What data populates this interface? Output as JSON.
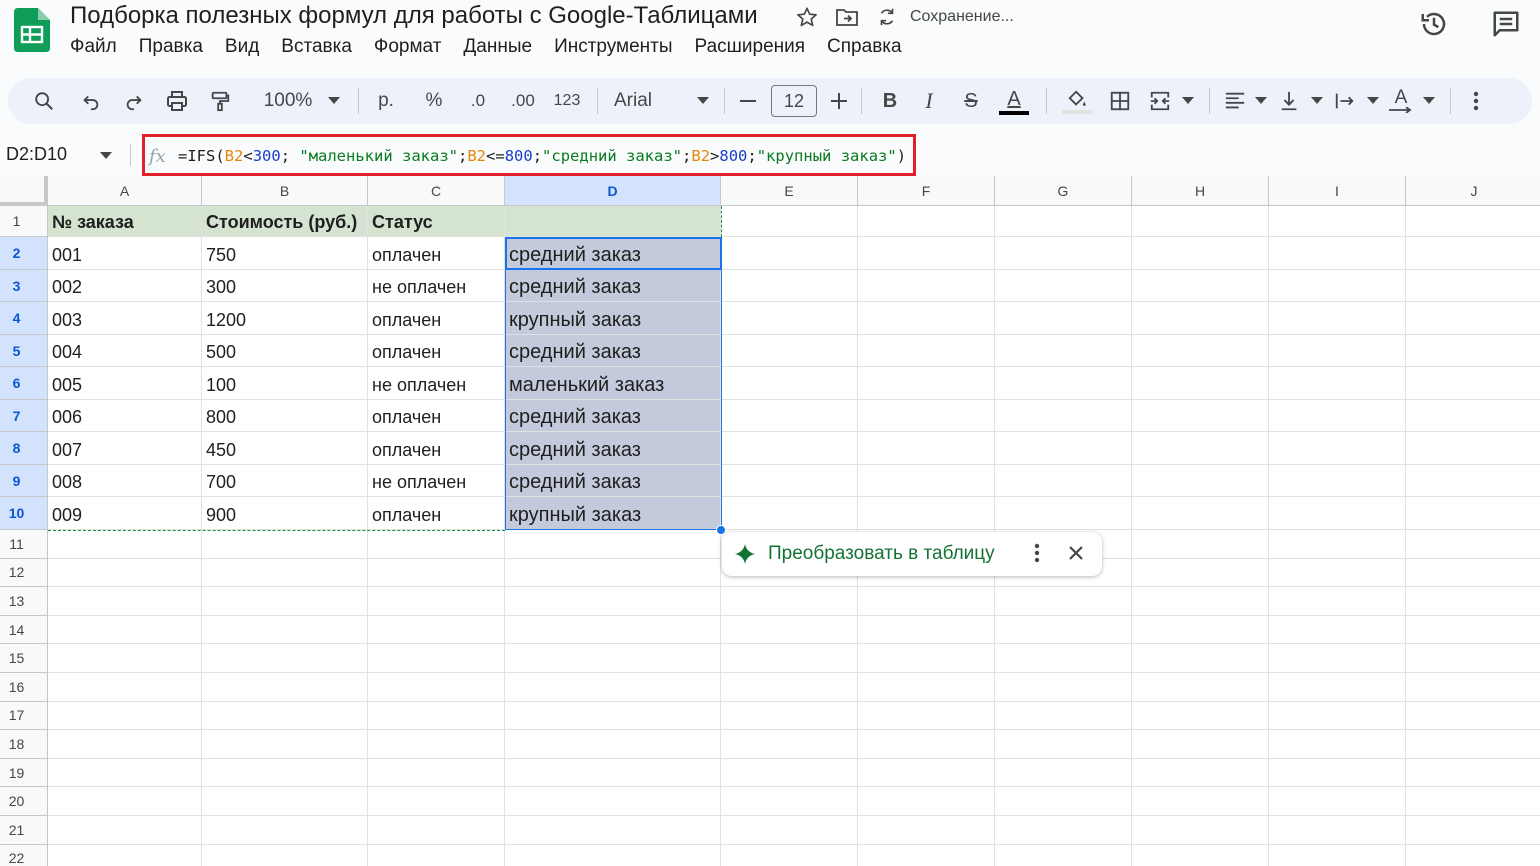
{
  "app": {
    "title": "Подборка полезных формул для работы с Google-Таблицами",
    "saving_status": "Сохранение...",
    "accent_color": "#0f9d58"
  },
  "menu": [
    "Файл",
    "Правка",
    "Вид",
    "Вставка",
    "Формат",
    "Данные",
    "Инструменты",
    "Расширения",
    "Справка"
  ],
  "toolbar": {
    "zoom": "100%",
    "currency": "р.",
    "percent": "%",
    "decrease_decimals": ".0",
    "increase_decimals": ".00",
    "more_formats": "123",
    "font": "Arial",
    "font_size": "12",
    "icons": [
      "search-icon",
      "undo-icon",
      "redo-icon",
      "print-icon",
      "paint-format-icon",
      "bold-icon",
      "italic-icon",
      "strikethrough-icon",
      "text-color-icon",
      "fill-color-icon",
      "borders-icon",
      "merge-cells-icon",
      "horizontal-align-icon",
      "vertical-align-icon",
      "text-wrap-icon",
      "text-rotation-icon",
      "more-icon"
    ]
  },
  "formula_bar": {
    "name_box": "D2:D10",
    "fx": "fx",
    "formula_parts": [
      {
        "t": "=IFS(",
        "c": "plain"
      },
      {
        "t": "B2",
        "c": "ref"
      },
      {
        "t": "<",
        "c": "plain"
      },
      {
        "t": "300",
        "c": "num"
      },
      {
        "t": "; ",
        "c": "plain"
      },
      {
        "t": "\"маленький заказ\"",
        "c": "str"
      },
      {
        "t": ";",
        "c": "plain"
      },
      {
        "t": "B2",
        "c": "ref"
      },
      {
        "t": "<=",
        "c": "plain"
      },
      {
        "t": "800",
        "c": "num"
      },
      {
        "t": ";",
        "c": "plain"
      },
      {
        "t": "\"средний заказ\"",
        "c": "str"
      },
      {
        "t": ";",
        "c": "plain"
      },
      {
        "t": "B2",
        "c": "ref"
      },
      {
        "t": ">",
        "c": "plain"
      },
      {
        "t": "800",
        "c": "num"
      },
      {
        "t": ";",
        "c": "plain"
      },
      {
        "t": "\"крупный заказ\"",
        "c": "str"
      },
      {
        "t": ")",
        "c": "plain"
      }
    ]
  },
  "sheet": {
    "columns": [
      "A",
      "B",
      "C",
      "D",
      "E",
      "F",
      "G",
      "H",
      "I",
      "J"
    ],
    "selected_column": "D",
    "row_numbers": [
      "1",
      "2",
      "3",
      "4",
      "5",
      "6",
      "7",
      "8",
      "9",
      "10",
      "11",
      "12",
      "13",
      "14",
      "15",
      "16",
      "17",
      "18",
      "19",
      "20",
      "21",
      "22"
    ],
    "selected_rows": [
      "2",
      "3",
      "4",
      "5",
      "6",
      "7",
      "8",
      "9",
      "10"
    ],
    "header_row": [
      "№ заказа",
      "Стоимость (руб.)",
      "Статус",
      ""
    ],
    "rows": [
      [
        "001",
        "750",
        "оплачен",
        "средний заказ"
      ],
      [
        "002",
        "300",
        "не оплачен",
        "средний заказ"
      ],
      [
        "003",
        "1200",
        "оплачен",
        "крупный заказ"
      ],
      [
        "004",
        "500",
        "оплачен",
        "средний заказ"
      ],
      [
        "005",
        "100",
        "не оплачен",
        "маленький заказ"
      ],
      [
        "006",
        "800",
        "оплачен",
        "средний заказ"
      ],
      [
        "007",
        "450",
        "оплачен",
        "средний заказ"
      ],
      [
        "008",
        "700",
        "не оплачен",
        "средний заказ"
      ],
      [
        "009",
        "900",
        "оплачен",
        "крупный заказ"
      ]
    ]
  },
  "suggestion_chip": {
    "label": "Преобразовать в таблицу",
    "icon": "sparkle-icon"
  }
}
